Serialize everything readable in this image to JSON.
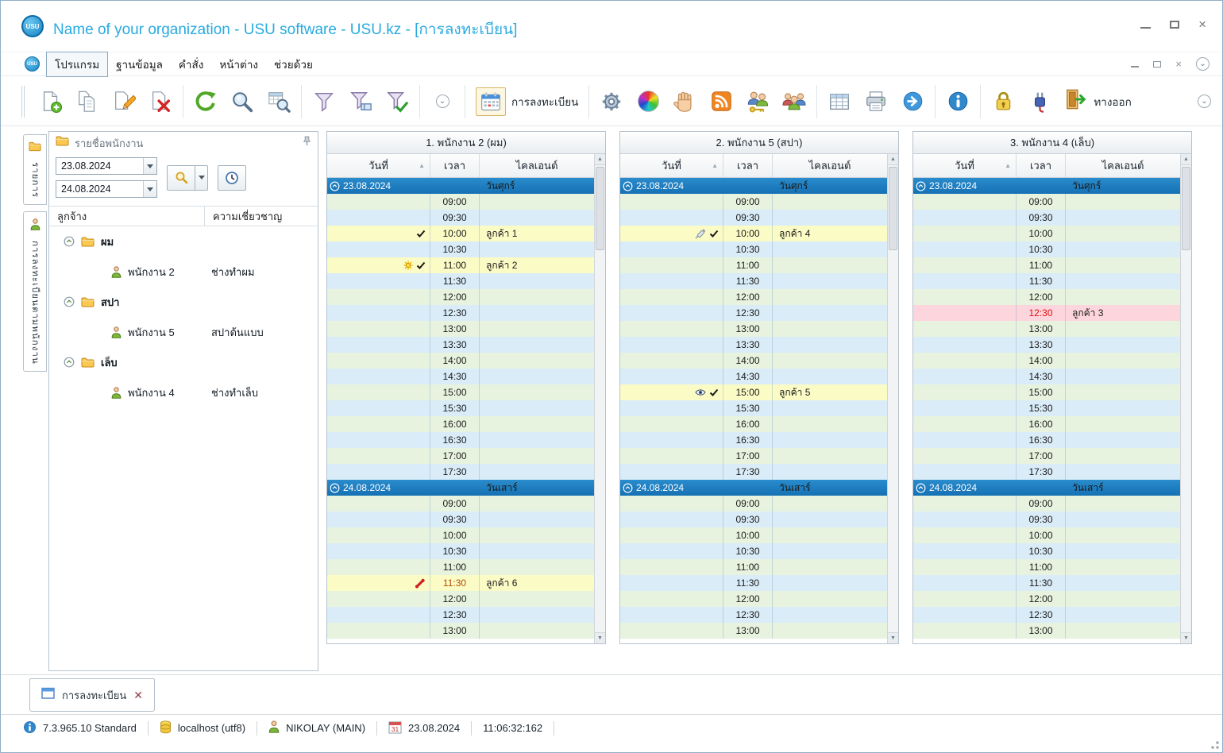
{
  "window": {
    "title": "Name of your organization - USU software - USU.kz - [การลงทะเบียน]"
  },
  "menu": {
    "items": [
      "โปรแกรม",
      "ฐานข้อมูล",
      "คำสั่ง",
      "หน้าต่าง",
      "ช่วยด้วย"
    ]
  },
  "toolbar": {
    "registration_label": "การลงทะเบียน",
    "exit_label": "ทางออก"
  },
  "left_tabs": [
    {
      "label": "รายการ",
      "icon": "folder-icon"
    },
    {
      "label": "การลงทะเบียนตามพนักงาน",
      "icon": "person-icon"
    }
  ],
  "sidebar": {
    "title": "รายชื่อพนักงาน",
    "date_from": "23.08.2024",
    "date_to": "24.08.2024",
    "columns": [
      "ลูกจ้าง",
      "ความเชี่ยวชาญ"
    ],
    "groups": [
      {
        "name": "ผม",
        "employees": [
          {
            "name": "พนักงาน 2",
            "specialty": "ช่างทำผม"
          }
        ]
      },
      {
        "name": "สปา",
        "employees": [
          {
            "name": "พนักงาน 5",
            "specialty": "สปาต้นแบบ"
          }
        ]
      },
      {
        "name": "เล็บ",
        "employees": [
          {
            "name": "พนักงาน 4",
            "specialty": "ช่างทำเล็บ"
          }
        ]
      }
    ]
  },
  "schedule": {
    "columns_headers": {
      "date": "วันที่",
      "time": "เวลา",
      "client": "ไคลเอนต์"
    },
    "days": [
      {
        "date": "23.08.2024",
        "day_name": "วันศุกร์",
        "times": [
          "09:00",
          "09:30",
          "10:00",
          "10:30",
          "11:00",
          "11:30",
          "12:00",
          "12:30",
          "13:00",
          "13:30",
          "14:00",
          "14:30",
          "15:00",
          "15:30",
          "16:00",
          "16:30",
          "17:00",
          "17:30"
        ]
      },
      {
        "date": "24.08.2024",
        "day_name": "วันเสาร์",
        "times": [
          "09:00",
          "09:30",
          "10:00",
          "10:30",
          "11:00",
          "11:30",
          "12:00",
          "12:30",
          "13:00"
        ]
      }
    ],
    "panels": [
      {
        "title": "1. พนักงาน 2 (ผม)",
        "appointments": [
          {
            "day": 0,
            "time": "10:00",
            "client": "ลูกค้า 1",
            "icons": [
              "check"
            ],
            "highlight": "yellow"
          },
          {
            "day": 0,
            "time": "11:00",
            "client": "ลูกค้า 2",
            "icons": [
              "sun",
              "check"
            ],
            "highlight": "yellow"
          },
          {
            "day": 1,
            "time": "11:30",
            "client": "ลูกค้า 6",
            "icons": [
              "phone"
            ],
            "highlight": "yellow",
            "time_color": "#b34a00"
          }
        ]
      },
      {
        "title": "2. พนักงาน 5 (สปา)",
        "appointments": [
          {
            "day": 0,
            "time": "10:00",
            "client": "ลูกค้า 4",
            "icons": [
              "syringe",
              "check"
            ],
            "highlight": "yellow"
          },
          {
            "day": 0,
            "time": "15:00",
            "client": "ลูกค้า 5",
            "icons": [
              "eye",
              "check"
            ],
            "highlight": "yellow"
          }
        ]
      },
      {
        "title": "3. พนักงาน 4 (เล็บ)",
        "appointments": [
          {
            "day": 0,
            "time": "12:30",
            "client": "ลูกค้า 3",
            "icons": [],
            "highlight": "pink",
            "time_color": "#e01010"
          }
        ]
      }
    ]
  },
  "bottom_tab": {
    "label": "การลงทะเบียน"
  },
  "statusbar": {
    "version": "7.3.965.10 Standard",
    "database": "localhost (utf8)",
    "user": "NIKOLAY (MAIN)",
    "calendar_day": "31",
    "date": "23.08.2024",
    "time": "11:06:32:162"
  },
  "colors": {
    "title_blue": "#29aae1",
    "date_header_blue": "#1877c2",
    "row_green": "#e7f3de",
    "row_blue": "#d9ecf8",
    "appointment_yellow": "#fbfbc6",
    "appointment_pink": "#fdd5dc"
  },
  "logo_text": "USU"
}
